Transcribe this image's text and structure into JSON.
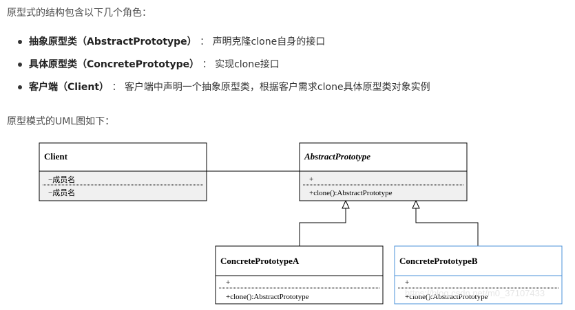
{
  "intro": "原型式的结构包含以下几个角色：",
  "roles": [
    {
      "name": "抽象原型类（AbstractPrototype）",
      "sep": "：",
      "desc": "声明克隆clone自身的接口"
    },
    {
      "name": "具体原型类（ConcretePrototype）",
      "sep": "：",
      "desc": "实现clone接口"
    },
    {
      "name": "客户端（Client）",
      "sep": "：",
      "desc": "客户端中声明一个抽象原型类，根据客户需求clone具体原型类对象实例"
    }
  ],
  "uml_intro": "原型模式的UML图如下：",
  "diagram": {
    "client": {
      "title": "Client",
      "members": [
        "−成员名",
        "−成员名"
      ]
    },
    "abstract": {
      "title": "AbstractPrototype",
      "attr": "+",
      "method": "+clone():AbstractPrototype"
    },
    "concrete_a": {
      "title": "ConcretePrototypeA",
      "attr": "+",
      "method": "+clone():AbstractPrototype"
    },
    "concrete_b": {
      "title": "ConcretePrototypeB",
      "attr": "+",
      "method": "+clone():AbstractPrototype"
    },
    "selected_border_color": "#4a90d9",
    "watermark": "https://blog.csdn.net/m0_37107433"
  }
}
